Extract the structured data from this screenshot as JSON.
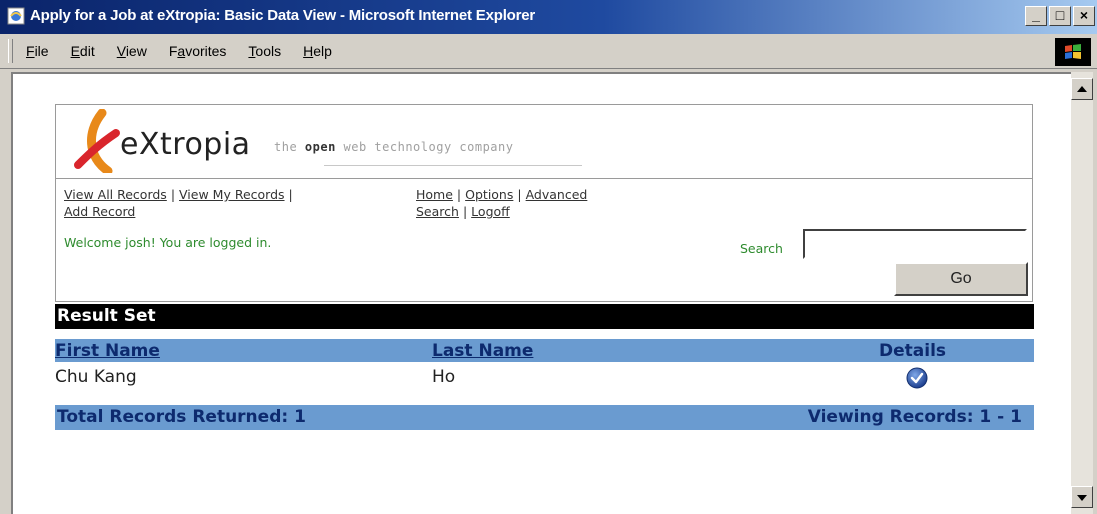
{
  "window": {
    "title": "Apply for a Job at eXtropia: Basic Data View - Microsoft Internet Explorer",
    "controls": [
      "_",
      "□",
      "×"
    ]
  },
  "menu": {
    "items": [
      {
        "label": "File",
        "accel": "F",
        "rest": "ile"
      },
      {
        "label": "Edit",
        "accel": "E",
        "rest": "dit"
      },
      {
        "label": "View",
        "accel": "V",
        "rest": "iew"
      },
      {
        "label": "Favorites",
        "accel": "a",
        "pre": "F",
        "rest": "vorites"
      },
      {
        "label": "Tools",
        "accel": "T",
        "rest": "ools"
      },
      {
        "label": "Help",
        "accel": "H",
        "rest": "elp"
      }
    ]
  },
  "logo": {
    "word": "eXtropia",
    "tag_pre": "the ",
    "tag_bold": "open",
    "tag_post": " web technology company"
  },
  "nav": {
    "view_all": "View All Records",
    "view_my": "View My Records",
    "add_record": "Add Record",
    "home": "Home",
    "options": "Options",
    "advanced_search": "Advanced Search",
    "logoff": "Logoff",
    "separator": "|"
  },
  "welcome": "Welcome josh! You are logged in.",
  "search": {
    "label": "Search",
    "value": "",
    "go_label": "Go"
  },
  "results": {
    "title": "Result Set",
    "columns": [
      "First Name",
      "Last Name",
      "Details"
    ],
    "rows": [
      {
        "first": "Chu Kang",
        "last": "Ho"
      }
    ],
    "total": "Total Records Returned: 1",
    "viewing": "Viewing Records: 1 - 1"
  },
  "colors": {
    "titlebar": "#0a246a",
    "header_bar": "#6a9bd0",
    "header_text": "#0d2a6e",
    "welcome_green": "#2e8b2e"
  }
}
